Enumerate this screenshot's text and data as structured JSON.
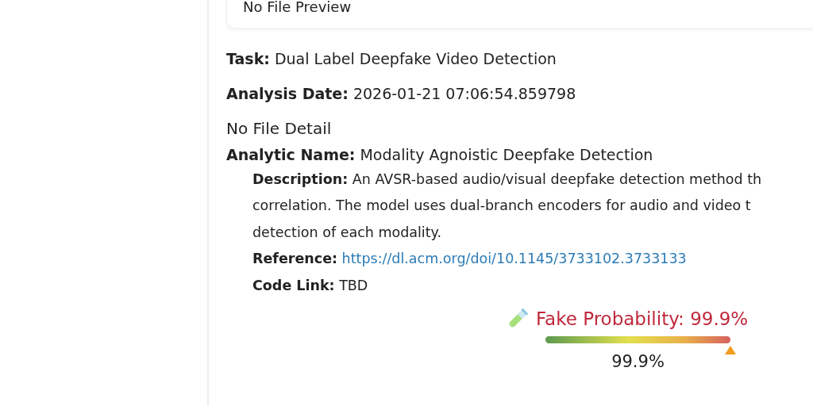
{
  "preview": {
    "text": "No File Preview"
  },
  "fields": [
    {
      "label": "Task:",
      "value": "Dual Label Deepfake Video Detection"
    },
    {
      "label": "Analysis Date:",
      "value": "2026-01-21 07:06:54.859798"
    }
  ],
  "file_detail": "No File Detail",
  "analytic": {
    "label": "Analytic Name:",
    "value": "Modality Agnoistic Deepfake Detection",
    "description": {
      "label": "Description:",
      "lines": [
        "An AVSR-based audio/visual deepfake detection method th",
        "correlation. The model uses dual-branch encoders for audio and video t",
        "detection of each modality."
      ]
    },
    "reference": {
      "label": "Reference:",
      "link": "https://dl.acm.org/doi/10.1145/3733102.3733133"
    },
    "code_link": {
      "label": "Code Link:",
      "value": "TBD"
    }
  },
  "result": {
    "title": "Fake Probability: 99.9%",
    "level": 0.999,
    "reading": "99.9%"
  }
}
